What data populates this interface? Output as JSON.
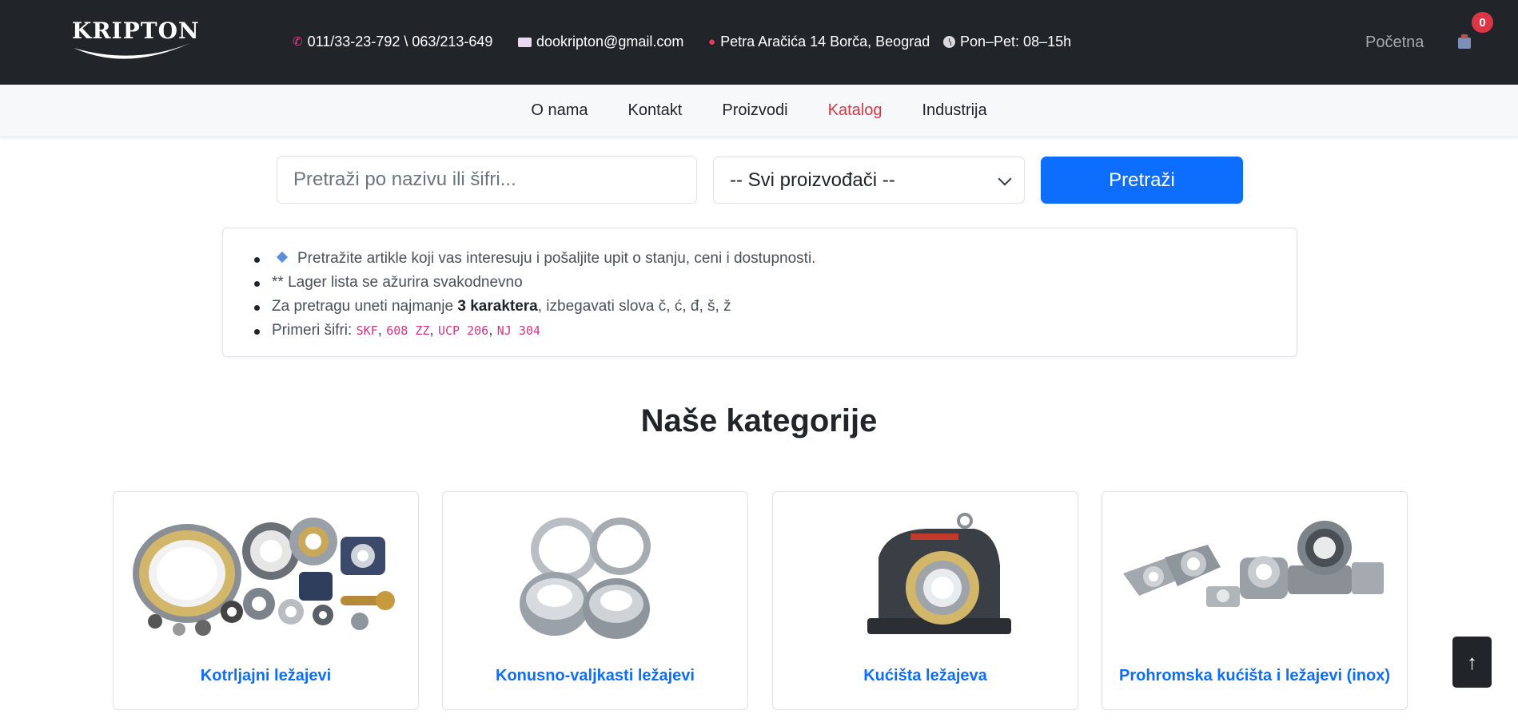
{
  "header": {
    "logo_text": "KRIPTON",
    "phone": "011/33-23-792 \\ 063/213-649",
    "email": "dookripton@gmail.com",
    "address": "Petra Aračića 14 Borča, Beograd",
    "hours": "Pon–Pet: 08–15h",
    "home_label": "Početna",
    "cart_count": "0",
    "icons": [
      "phone-icon",
      "mail-icon",
      "pin-icon",
      "clock-icon",
      "cart-icon"
    ]
  },
  "nav": {
    "items": [
      {
        "label": "O nama"
      },
      {
        "label": "Kontakt"
      },
      {
        "label": "Proizvodi"
      },
      {
        "label": "Katalog",
        "active": true
      },
      {
        "label": "Industrija"
      }
    ],
    "active_color": "#dc3545"
  },
  "search": {
    "placeholder": "Pretraži po nazivu ili šifri...",
    "value": "",
    "manufacturer_selected": "-- Svi proizvođači --",
    "button_label": "Pretraži",
    "button_color": "#0d6efd"
  },
  "info": {
    "line1": "Pretražite artikle koji vas interesuju i pošaljite upit o stanju, ceni i dostupnosti.",
    "line2": "** Lager lista se ažurira svakodnevno",
    "line3_pre": "Za pretragu uneti najmanje ",
    "line3_bold": "3 karaktera",
    "line3_post": ", izbegavati slova č, ć, đ, š, ž",
    "line4_pre": "Primeri šifri: ",
    "examples": [
      "SKF",
      "608 ZZ",
      "UCP 206",
      "NJ 304"
    ],
    "separator": ", "
  },
  "categories": {
    "title": "Naše kategorije",
    "items": [
      {
        "label": "Kotrljajni ležajevi"
      },
      {
        "label": "Konusno-valjkasti ležajevi"
      },
      {
        "label": "Kućišta ležajeva"
      },
      {
        "label": "Prohromska kućišta i ležajevi (inox)"
      }
    ]
  },
  "back_to_top": "↑"
}
